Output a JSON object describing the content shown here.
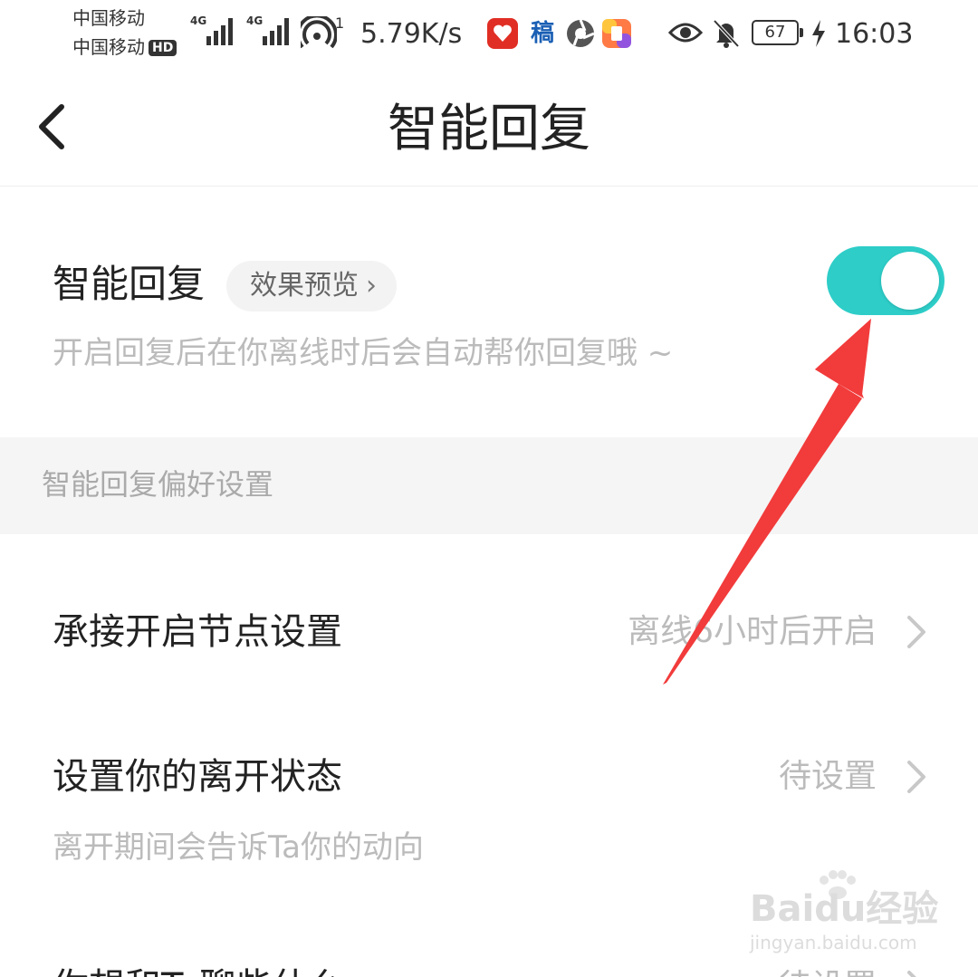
{
  "status_bar": {
    "carrier_1": "中国移动",
    "carrier_2": "中国移动",
    "hd_badge": "HD",
    "network_1": "4G",
    "network_2": "4G",
    "hotspot_count": "1",
    "speed": "5.79K/s",
    "app_icon_text": "稿",
    "battery": "67",
    "time": "16:03",
    "icons": [
      "signal-icon",
      "hotspot-icon",
      "pinduoduo-icon",
      "browser-icon",
      "app-icon",
      "eye-icon",
      "bell-off-icon",
      "battery-icon",
      "charging-icon"
    ]
  },
  "header": {
    "back_icon": "chevron-left-icon",
    "title": "智能回复"
  },
  "smart_reply": {
    "label": "智能回复",
    "preview_chip": "效果预览",
    "chip_icon": "chevron-right-icon",
    "description": "开启回复后在你离线时后会自动帮你回复哦 ~",
    "enabled": true,
    "toggle_color": "#2ecdc8"
  },
  "preferences": {
    "section_title": "智能回复偏好设置",
    "items": [
      {
        "label": "承接开启节点设置",
        "value": "离线6小时后开启",
        "icon": "chevron-right-icon"
      },
      {
        "label": "设置你的离开状态",
        "value": "待设置",
        "description": "离开期间会告诉Ta你的动向",
        "icon": "chevron-right-icon"
      },
      {
        "label": "你想和Ta聊些什么",
        "value": "待设置",
        "icon": "chevron-right-icon"
      }
    ]
  },
  "watermark": {
    "logo": "Baidu经验",
    "url": "jingyan.baidu.com"
  },
  "annotation": {
    "type": "red-arrow",
    "color": "#f23b3b",
    "points_to": "smart-reply-toggle"
  }
}
